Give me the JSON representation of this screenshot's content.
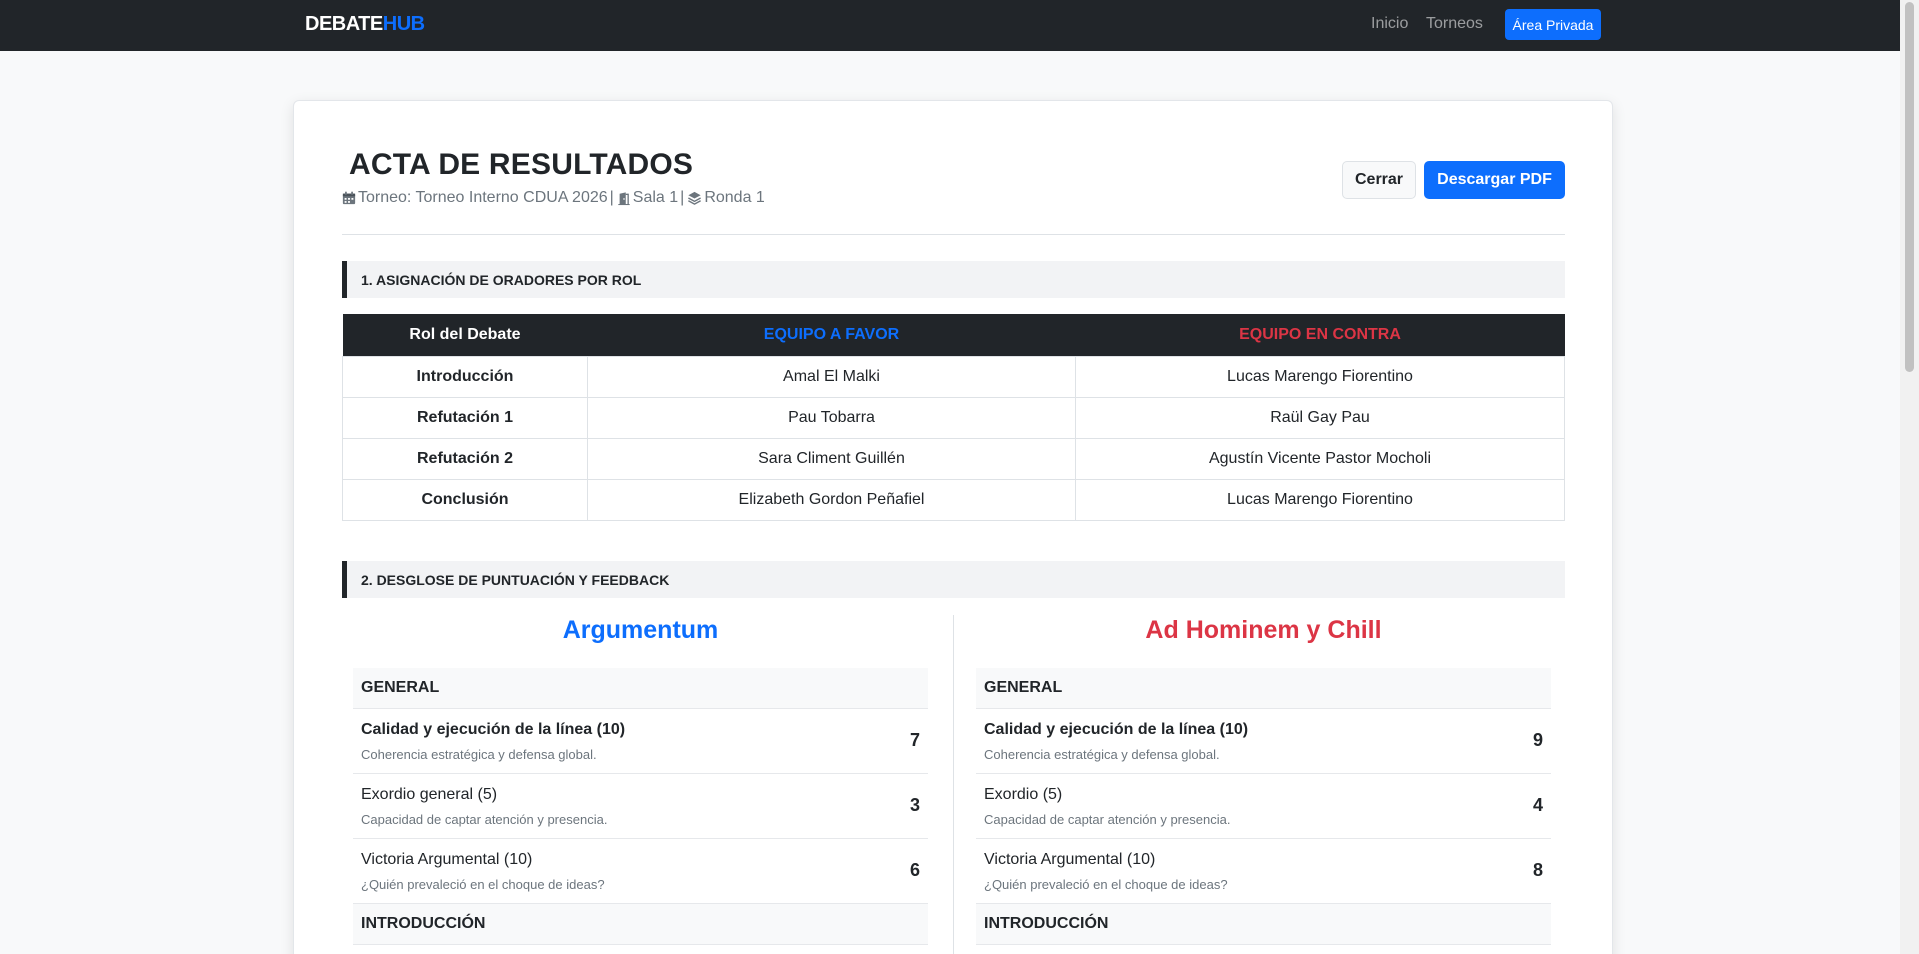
{
  "navbar": {
    "brand_part1": "DEBATE",
    "brand_part2": "HUB",
    "links": [
      "Inicio",
      "Torneos"
    ],
    "private_button": "Área Privada"
  },
  "header": {
    "title": "ACTA DE RESULTADOS",
    "tournament": "Torneo: Torneo Interno CDUA 2026",
    "room": "Sala 1",
    "round": "Ronda 1",
    "separator": "|",
    "close_button": "Cerrar",
    "pdf_button": "Descargar PDF"
  },
  "section1": {
    "title": "1. ASIGNACIÓN DE ORADORES POR ROL",
    "columns": [
      "Rol del Debate",
      "EQUIPO A FAVOR",
      "EQUIPO EN CONTRA"
    ],
    "rows": [
      {
        "role": "Introducción",
        "favor": "Amal El Malki",
        "contra": "Lucas Marengo Fiorentino"
      },
      {
        "role": "Refutación 1",
        "favor": "Pau Tobarra",
        "contra": "Raül Gay Pau"
      },
      {
        "role": "Refutación 2",
        "favor": "Sara Climent Guillén",
        "contra": "Agustín Vicente Pastor Mocholi"
      },
      {
        "role": "Conclusión",
        "favor": "Elizabeth Gordon Peñafiel",
        "contra": "Lucas Marengo Fiorentino"
      }
    ]
  },
  "section2": {
    "title": "2. DESGLOSE DE PUNTUACIÓN Y FEEDBACK",
    "team_a": {
      "name": "Argumentum",
      "category": "GENERAL",
      "items": [
        {
          "criterion": "Calidad y ejecución de la línea (10)",
          "description": "Coherencia estratégica y defensa global.",
          "score": "7"
        },
        {
          "criterion": "Exordio general (5)",
          "description": "Capacidad de captar atención y presencia.",
          "score": "3"
        },
        {
          "criterion": "Victoria Argumental (10)",
          "description": "¿Quién prevaleció en el choque de ideas?",
          "score": "6"
        }
      ],
      "next_category": "INTRODUCCIÓN"
    },
    "team_b": {
      "name": "Ad Hominem y Chill",
      "category": "GENERAL",
      "items": [
        {
          "criterion": "Calidad y ejecución de la línea (10)",
          "description": "Coherencia estratégica y defensa global.",
          "score": "9"
        },
        {
          "criterion": "Exordio (5)",
          "description": "Capacidad de captar atención y presencia.",
          "score": "4"
        },
        {
          "criterion": "Victoria Argumental (10)",
          "description": "¿Quién prevaleció en el choque de ideas?",
          "score": "8"
        }
      ],
      "next_category": "INTRODUCCIÓN"
    }
  },
  "colors": {
    "navbar": "#212529",
    "primary": "#0d6efd",
    "danger": "#dc3545",
    "muted": "#6c757d"
  },
  "icons": [
    "calendar-icon",
    "door-icon",
    "layers-icon"
  ]
}
